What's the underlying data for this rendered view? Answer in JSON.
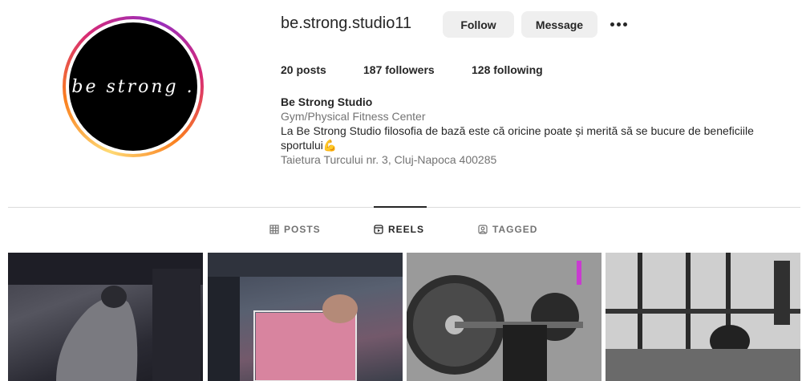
{
  "profile": {
    "avatar_text": "be strong .",
    "username": "be.strong.studio11",
    "follow_label": "Follow",
    "message_label": "Message",
    "more_icon": "more-options-icon"
  },
  "stats": {
    "posts": "20 posts",
    "followers": "187 followers",
    "following": "128 following"
  },
  "bio": {
    "name": "Be Strong Studio",
    "category": "Gym/Physical Fitness Center",
    "description": "La Be Strong Studio filosofia de bază este că oricine poate și merită să se bucure de beneficiile sportului💪",
    "address": "Taietura Turcului nr. 3, Cluj-Napoca 400285"
  },
  "tabs": {
    "posts": "POSTS",
    "reels": "REELS",
    "tagged": "TAGGED",
    "active": "REELS"
  },
  "colors": {
    "button_bg": "#efefef",
    "muted_text": "#737373",
    "divider": "#dbdbdb",
    "ring_gradient": [
      "#feda75",
      "#fa7e1e",
      "#d62976",
      "#962fbf"
    ]
  },
  "reels": [
    {
      "description": "person-in-grey-shirt-dark-gym"
    },
    {
      "description": "person-in-pink-shirt-gym"
    },
    {
      "description": "loaded-barbell-squat"
    },
    {
      "description": "gym-racks-training"
    }
  ]
}
